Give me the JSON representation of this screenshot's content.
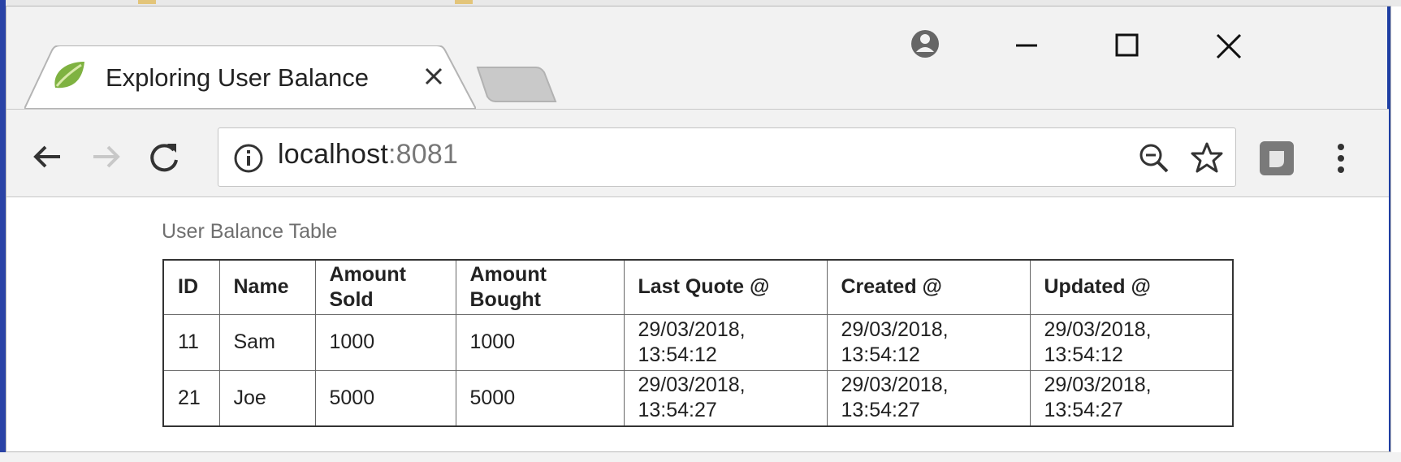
{
  "browser": {
    "tab": {
      "title": "Exploring User Balance",
      "favicon": "spring-leaf-icon",
      "close_icon": "close-icon"
    },
    "new_tab_icon": "new-tab-icon",
    "window_controls": [
      "account-icon",
      "minimize-icon",
      "maximize-icon",
      "close-icon"
    ],
    "nav": [
      "back-arrow-icon",
      "forward-arrow-icon",
      "reload-icon"
    ],
    "address": {
      "host": "localhost",
      "port": ":8081",
      "info_icon": "info-icon"
    },
    "omnibox_actions": [
      "zoom-out-icon",
      "star-icon"
    ],
    "extension_icon": "extension-icon",
    "menu_icon": "kebab-menu-icon",
    "accent": "#1f3fa3"
  },
  "page": {
    "caption": "User Balance Table",
    "columns": [
      [
        "ID"
      ],
      [
        "Name"
      ],
      [
        "Amount",
        "Sold"
      ],
      [
        "Amount",
        "Bought"
      ],
      [
        "Last Quote @"
      ],
      [
        "Created @"
      ],
      [
        "Updated @"
      ]
    ],
    "rows": [
      {
        "id": "11",
        "name": "Sam",
        "sold": "1000",
        "bought": "1000",
        "quote": [
          "29/03/2018,",
          "13:54:12"
        ],
        "created": [
          "29/03/2018,",
          "13:54:12"
        ],
        "updated": [
          "29/03/2018,",
          "13:54:12"
        ]
      },
      {
        "id": "21",
        "name": "Joe",
        "sold": "5000",
        "bought": "5000",
        "quote": [
          "29/03/2018,",
          "13:54:27"
        ],
        "created": [
          "29/03/2018,",
          "13:54:27"
        ],
        "updated": [
          "29/03/2018,",
          "13:54:27"
        ]
      }
    ]
  }
}
